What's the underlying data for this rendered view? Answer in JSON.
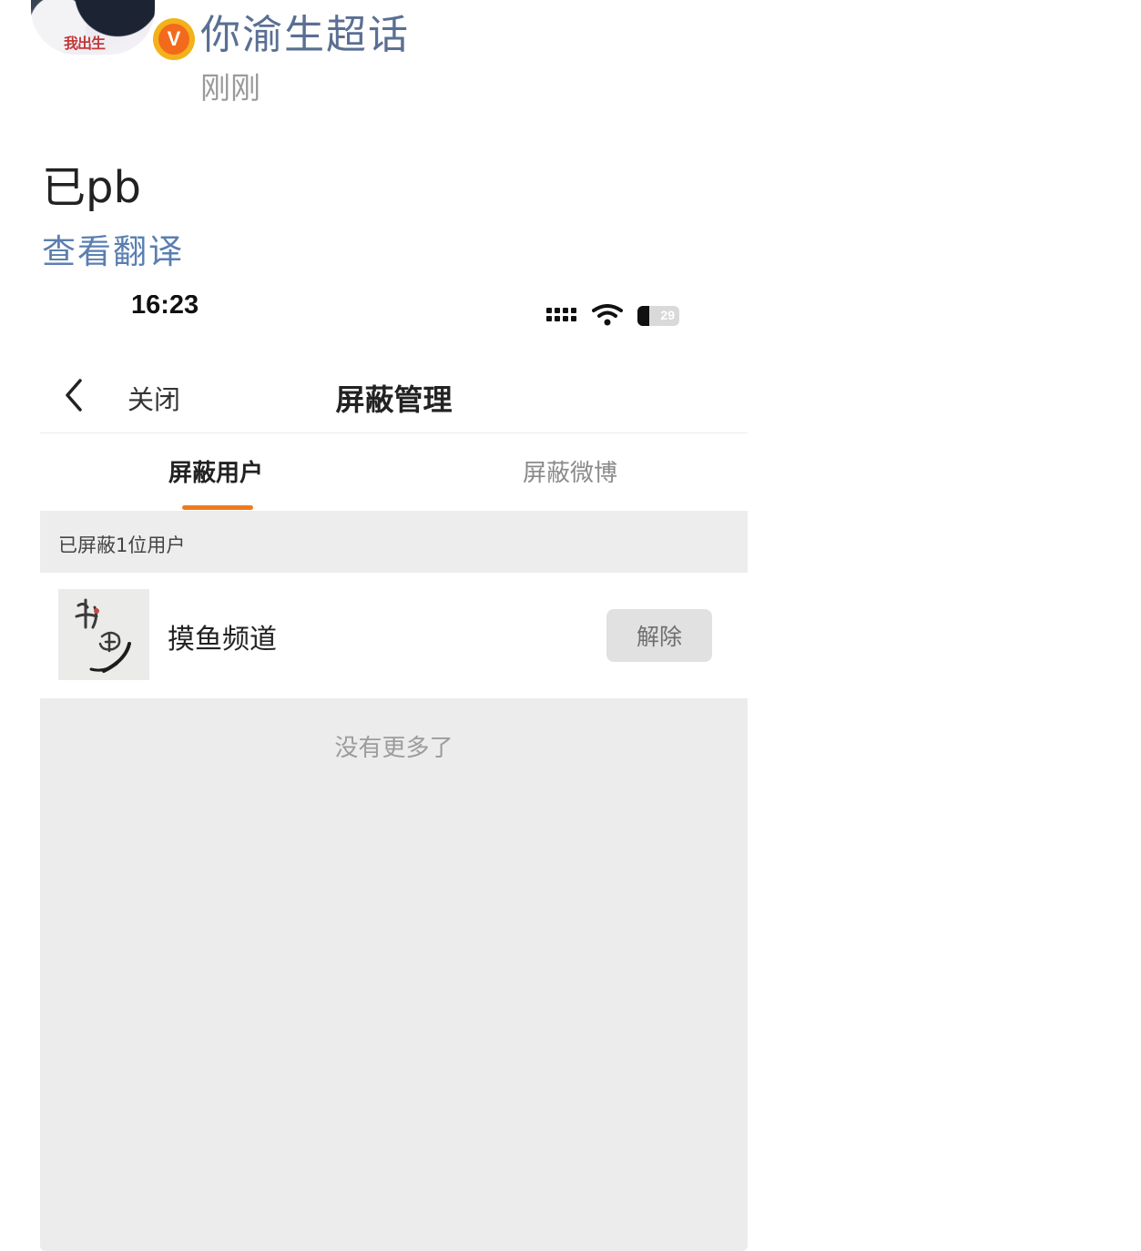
{
  "post": {
    "avatar_text": "我出生",
    "verified_mark": "V",
    "username": "你渝生超话",
    "time": "刚刚",
    "text": "已pb",
    "translate_link": "查看翻译"
  },
  "screenshot": {
    "status_bar": {
      "time": "16:23",
      "battery_level": "29",
      "battery_fraction": 0.29,
      "icons": [
        "signal-icon",
        "wifi-icon",
        "battery-icon"
      ]
    },
    "navbar": {
      "back_icon": "chevron-left-icon",
      "close_label": "关闭",
      "title": "屏蔽管理"
    },
    "tabs": [
      {
        "label": "屏蔽用户",
        "active": true
      },
      {
        "label": "屏蔽微博",
        "active": false
      }
    ],
    "accent_color": "#f07b1e",
    "list_header": "已屏蔽1位用户",
    "blocked_users": [
      {
        "name": "摸鱼频道",
        "avatar_text": "摸鱼",
        "action_label": "解除"
      }
    ],
    "footer_text": "没有更多了"
  }
}
